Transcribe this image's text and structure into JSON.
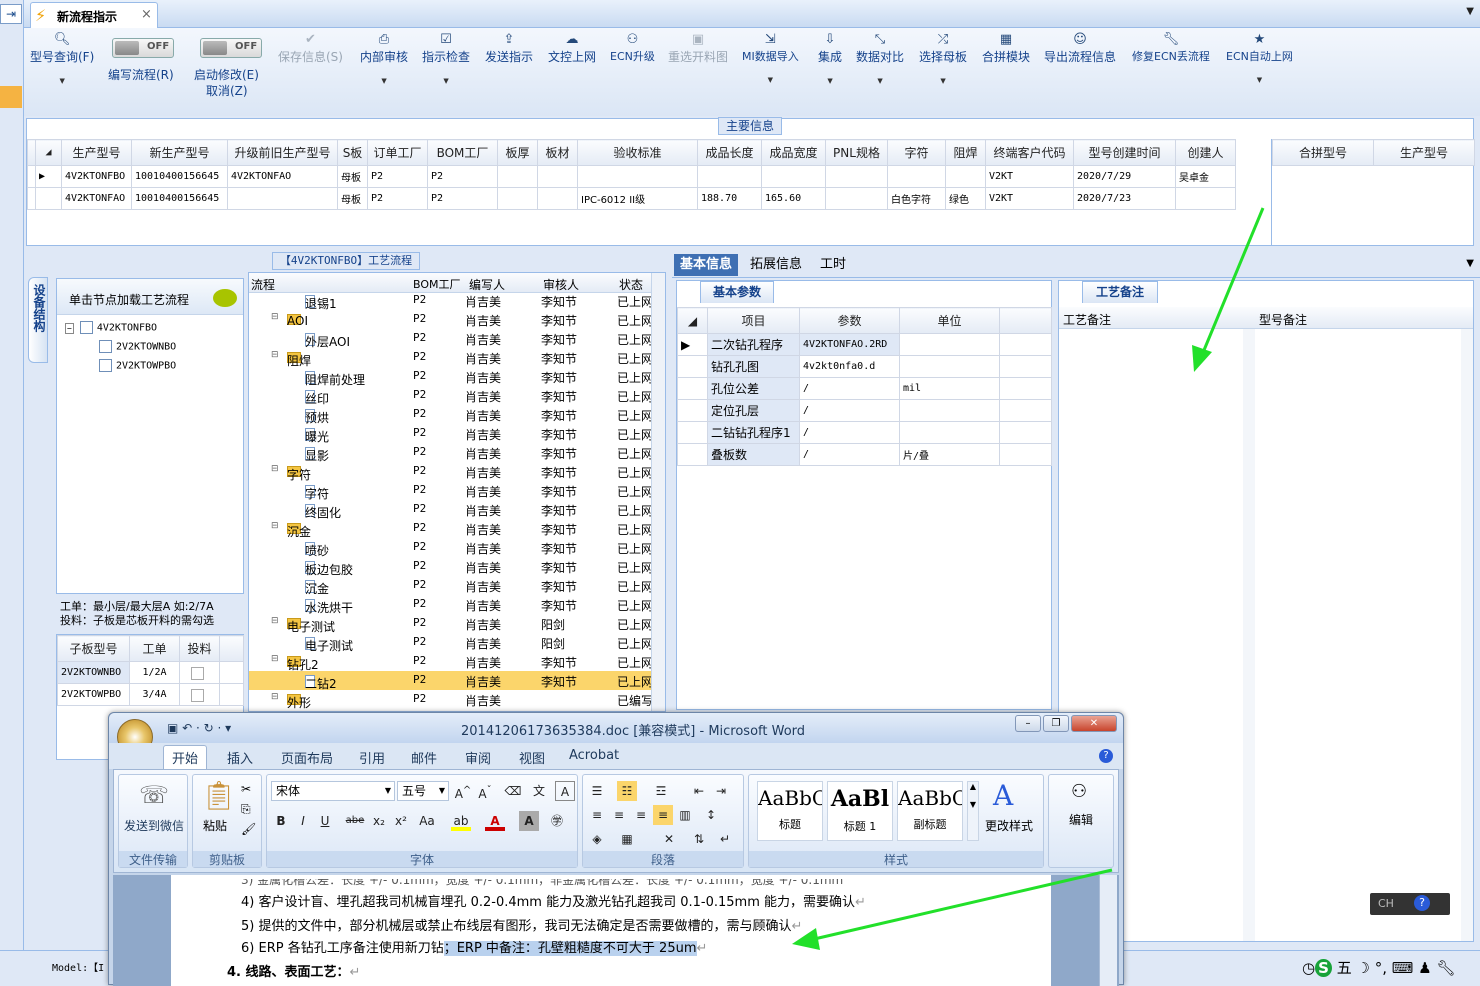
{
  "app": {
    "tab_title": "新流程指示",
    "close_glyph": "×",
    "bolt_icon": "lightning-icon"
  },
  "toolbar": {
    "model_query": "型号查询(F)",
    "edit_flow": "编写流程(R)",
    "start_modify": "启动修改(E)",
    "cancel": "取消(Z)",
    "toggle_off": "OFF",
    "save_info": "保存信息(S)",
    "internal_review": "内部审核",
    "instruction_check": "指示检查",
    "send_instruction": "发送指示",
    "file_upload": "文控上网",
    "ecn_upgrade": "ECN升级",
    "reselect_drawing": "重选开料图",
    "mi_import": "MI数据导入",
    "integrate": "集成",
    "data_compare": "数据对比",
    "select_master": "选择母板",
    "combine_module": "合拼模块",
    "export_flow": "导出流程信息",
    "repair_ecn": "修复ECN丢流程",
    "ecn_auto_upload": "ECN自动上网"
  },
  "main_info": {
    "legend": "主要信息",
    "columns": [
      "生产型号",
      "新生产型号",
      "升级前旧生产型号",
      "S板",
      "订单工厂",
      "BOM工厂",
      "板厚",
      "板材",
      "验收标准",
      "成品长度",
      "成品宽度",
      "PNL规格",
      "字符",
      "阻焊",
      "终端客户代码",
      "型号创建时间",
      "创建人"
    ],
    "rows": [
      [
        "4V2KTONFBO",
        "10010400156645",
        "4V2KTONFAO",
        "母板",
        "P2",
        "P2",
        "",
        "",
        "",
        "",
        "",
        "",
        "",
        "",
        "V2KT",
        "2020/7/29",
        "吴卓金"
      ],
      [
        "4V2KTONFAO",
        "10010400156645",
        "",
        "母板",
        "P2",
        "P2",
        "",
        "",
        "IPC-6012 II级",
        "188.70",
        "165.60",
        "",
        "白色字符",
        "绿色",
        "V2KT",
        "2020/7/23",
        ""
      ]
    ],
    "combine_columns": [
      "合拼型号",
      "生产型号"
    ]
  },
  "left_panel": {
    "vertical_tab": "设备结构",
    "header": "单击节点加载工艺流程",
    "tree": {
      "root": "4V2KTONFBO",
      "children": [
        "2V2KTOWNBO",
        "2V2KTOWPBO"
      ]
    },
    "note1": "工单：最小层/最大层A 如:2/7A",
    "note2": "投料：子板是芯板开料的需勾选",
    "sub_columns": [
      "子板型号",
      "工单",
      "投料"
    ],
    "sub_rows": [
      [
        "2V2KTOWNBO",
        "1/2A"
      ],
      [
        "2V2KTOWPBO",
        "3/4A"
      ]
    ]
  },
  "flow": {
    "title": "【4V2KTONFBO】工艺流程",
    "columns": [
      "流程",
      "BOM工厂",
      "编写人",
      "审核人",
      "状态"
    ],
    "rows": [
      {
        "name": "退锡1",
        "type": "page",
        "bom": "P2",
        "writer": "肖吉美",
        "reviewer": "李知节",
        "status": "已上网"
      },
      {
        "name": "AOI",
        "type": "folder",
        "bom": "P2",
        "writer": "肖吉美",
        "reviewer": "李知节",
        "status": "已上网"
      },
      {
        "name": "外层AOI",
        "type": "page",
        "bom": "P2",
        "writer": "肖吉美",
        "reviewer": "李知节",
        "status": "已上网"
      },
      {
        "name": "阻焊",
        "type": "folder",
        "bom": "P2",
        "writer": "肖吉美",
        "reviewer": "李知节",
        "status": "已上网"
      },
      {
        "name": "阻焊前处理",
        "type": "page",
        "bom": "P2",
        "writer": "肖吉美",
        "reviewer": "李知节",
        "status": "已上网"
      },
      {
        "name": "丝印",
        "type": "page",
        "bom": "P2",
        "writer": "肖吉美",
        "reviewer": "李知节",
        "status": "已上网"
      },
      {
        "name": "预烘",
        "type": "page",
        "bom": "P2",
        "writer": "肖吉美",
        "reviewer": "李知节",
        "status": "已上网"
      },
      {
        "name": "曝光",
        "type": "page",
        "bom": "P2",
        "writer": "肖吉美",
        "reviewer": "李知节",
        "status": "已上网"
      },
      {
        "name": "显影",
        "type": "page",
        "bom": "P2",
        "writer": "肖吉美",
        "reviewer": "李知节",
        "status": "已上网"
      },
      {
        "name": "字符",
        "type": "folder",
        "bom": "P2",
        "writer": "肖吉美",
        "reviewer": "李知节",
        "status": "已上网"
      },
      {
        "name": "字符",
        "type": "page",
        "bom": "P2",
        "writer": "肖吉美",
        "reviewer": "李知节",
        "status": "已上网"
      },
      {
        "name": "终固化",
        "type": "page",
        "bom": "P2",
        "writer": "肖吉美",
        "reviewer": "李知节",
        "status": "已上网"
      },
      {
        "name": "沉金",
        "type": "folder",
        "bom": "P2",
        "writer": "肖吉美",
        "reviewer": "李知节",
        "status": "已上网"
      },
      {
        "name": "喷砂",
        "type": "page",
        "bom": "P2",
        "writer": "肖吉美",
        "reviewer": "李知节",
        "status": "已上网"
      },
      {
        "name": "板边包胶",
        "type": "page",
        "bom": "P2",
        "writer": "肖吉美",
        "reviewer": "李知节",
        "status": "已上网"
      },
      {
        "name": "沉金",
        "type": "page",
        "bom": "P2",
        "writer": "肖吉美",
        "reviewer": "李知节",
        "status": "已上网"
      },
      {
        "name": "水洗烘干",
        "type": "page",
        "bom": "P2",
        "writer": "肖吉美",
        "reviewer": "李知节",
        "status": "已上网"
      },
      {
        "name": "电子测试",
        "type": "folder",
        "bom": "P2",
        "writer": "肖吉美",
        "reviewer": "阳剑",
        "status": "已上网"
      },
      {
        "name": "电子测试",
        "type": "page",
        "bom": "P2",
        "writer": "肖吉美",
        "reviewer": "阳剑",
        "status": "已上网"
      },
      {
        "name": "钻孔2",
        "type": "folder",
        "bom": "P2",
        "writer": "肖吉美",
        "reviewer": "李知节",
        "status": "已上网"
      },
      {
        "name": "二钻2",
        "type": "page",
        "bom": "P2",
        "writer": "肖吉美",
        "reviewer": "李知节",
        "status": "已上网"
      },
      {
        "name": "外形",
        "type": "folder",
        "bom": "P2",
        "writer": "肖吉美",
        "reviewer": "",
        "status": "已编写"
      }
    ]
  },
  "right_tabs": [
    "基本信息",
    "拓展信息",
    "工时"
  ],
  "basic": {
    "tab": "基本参数",
    "columns": [
      "项目",
      "参数",
      "单位"
    ],
    "rows": [
      [
        "二次钻孔程序",
        "4V2KTONFAO.2RD",
        ""
      ],
      [
        "钻孔孔图",
        "4v2kt0nfa0.d",
        ""
      ],
      [
        "孔位公差",
        "/",
        "mil"
      ],
      [
        "定位孔层",
        "/",
        ""
      ],
      [
        "二钻钻孔程序1",
        "/",
        ""
      ],
      [
        "叠板数",
        "/",
        "片/叠"
      ]
    ]
  },
  "process_notes": {
    "tab": "工艺备注",
    "col1": "工艺备注",
    "col2": "型号备注"
  },
  "status_bar": {
    "model_label": "Model:【I"
  },
  "word": {
    "title": "20141206173635384.doc [兼容模式] - Microsoft Word",
    "tabs": [
      "开始",
      "插入",
      "页面布局",
      "引用",
      "邮件",
      "审阅",
      "视图",
      "Acrobat"
    ],
    "send_wechat": "发送到微信",
    "file_transfer": "文件传输",
    "paste": "粘贴",
    "clipboard": "剪贴板",
    "font_name": "宋体",
    "font_size": "五号",
    "font_group": "字体",
    "paragraph_group": "段落",
    "styles_group": "样式",
    "style_sample_1": "AaBbC",
    "style_sample_2": "AaBl",
    "style_sample_3": "AaBbC",
    "style_1": "标题",
    "style_2": "标题 1",
    "style_3": "副标题",
    "change_styles": "更改样式",
    "edit": "编辑",
    "line4": "4)  客户设计盲、埋孔超我司机械盲埋孔 0.2-0.4mm 能力及激光钻孔超我司 0.1-0.15mm 能力，需要确认",
    "line5": "5)  提供的文件中，部分机械层或禁止布线层有图形，我司无法确定是否需要做槽的，需与顾确认",
    "line6a": "6)  ERP 各钻孔工序备注使用新刀钻",
    "line6b": "；ERP 中备注：孔壁粗糙度不可大于 25um",
    "heading4": "4.  线路、表面工艺：",
    "return_mark": "↵"
  },
  "ime": {
    "lang": "CH",
    "mode": "五"
  },
  "colors": {
    "accent": "#3e6fb3",
    "selected_row": "#fbd56b",
    "arrow": "#22e02a"
  }
}
